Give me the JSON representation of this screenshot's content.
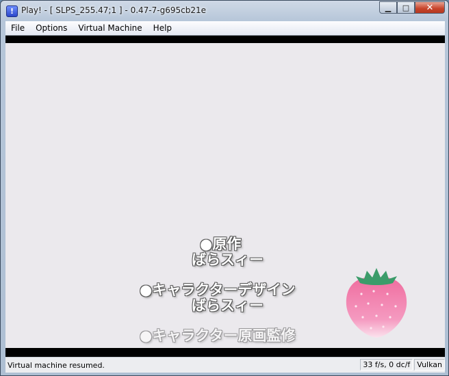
{
  "window": {
    "title": "Play! - [ SLPS_255.47;1 ] - 0.47-7-g695cb21e",
    "app_icon_glyph": "!",
    "minimize_glyph": "▁",
    "maximize_glyph": "□",
    "close_glyph": "✕"
  },
  "menu": {
    "items": [
      {
        "label": "File"
      },
      {
        "label": "Options"
      },
      {
        "label": "Virtual Machine"
      },
      {
        "label": "Help"
      }
    ]
  },
  "game": {
    "credits": [
      {
        "line1": "●原作",
        "line2": "ばらスィー"
      },
      {
        "line1": "●キャラクターデザイン",
        "line2": "ばらスィー"
      },
      {
        "line1": "●キャラクター原画監修",
        "line2": ""
      }
    ],
    "strawberry_icon": "strawberry-icon",
    "colors": {
      "strawberry": "#f07aa7",
      "leaves": "#3b9c6a",
      "background": "#ebe9ed"
    }
  },
  "status": {
    "message": "Virtual machine resumed.",
    "fps": "33 f/s, 0 dc/f",
    "renderer": "Vulkan"
  }
}
